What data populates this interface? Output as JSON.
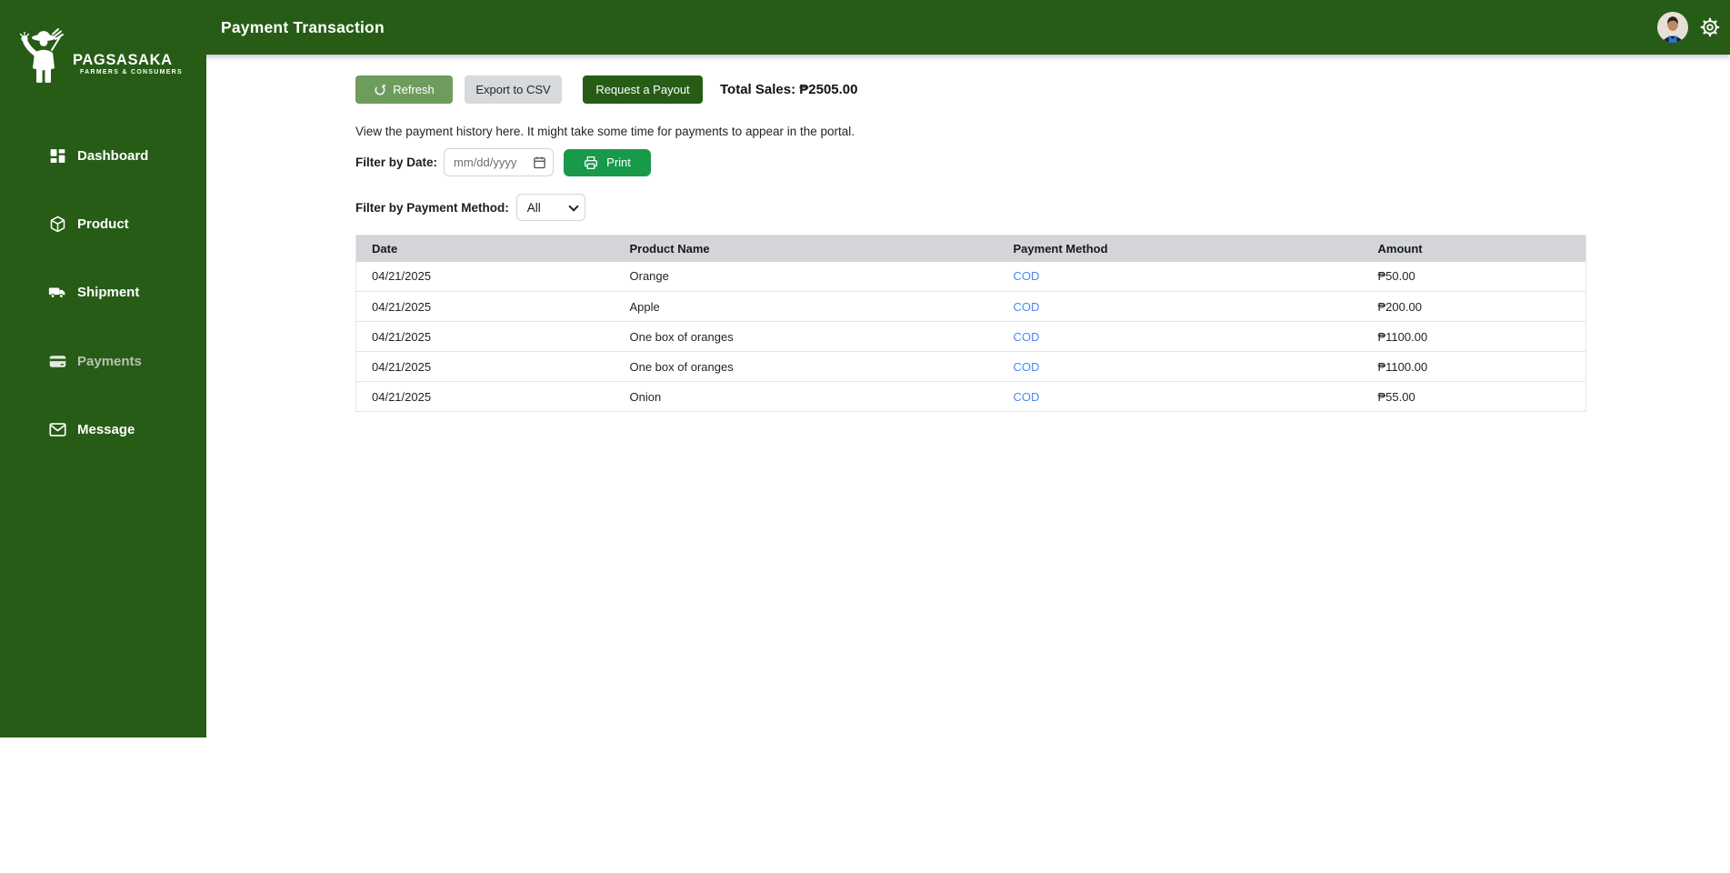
{
  "header": {
    "title": "Payment Transaction"
  },
  "sidebar": {
    "logo": {
      "title": "PAGSASAKA",
      "subtitle": "FARMERS & CONSUMERS",
      "icon": "farmer-logo-icon"
    },
    "items": [
      {
        "label": "Dashboard",
        "icon": "dashboard-grid-icon",
        "active": false
      },
      {
        "label": "Product",
        "icon": "box-icon",
        "active": false
      },
      {
        "label": "Shipment",
        "icon": "truck-icon",
        "active": false
      },
      {
        "label": "Payments",
        "icon": "credit-card-icon",
        "active": true
      },
      {
        "label": "Message",
        "icon": "envelope-icon",
        "active": false
      }
    ]
  },
  "toolbar": {
    "refresh_label": "Refresh",
    "export_label": "Export to CSV",
    "payout_label": "Request a Payout",
    "total_sales_label": "Total Sales:",
    "total_sales_value": "₱2505.00"
  },
  "info_text": "View the payment history here. It might take some time for payments to appear in the portal.",
  "filters": {
    "date_label": "Filter by Date:",
    "date_placeholder": "mm/dd/yyyy",
    "print_label": "Print",
    "method_label": "Filter by Payment Method:",
    "method_value": "All"
  },
  "table": {
    "columns": [
      "Date",
      "Product Name",
      "Payment Method",
      "Amount"
    ],
    "rows": [
      {
        "date": "04/21/2025",
        "product": "Orange",
        "method": "COD",
        "amount": "₱50.00"
      },
      {
        "date": "04/21/2025",
        "product": "Apple",
        "method": "COD",
        "amount": "₱200.00"
      },
      {
        "date": "04/21/2025",
        "product": "One box of oranges",
        "method": "COD",
        "amount": "₱1100.00"
      },
      {
        "date": "04/21/2025",
        "product": "One box of oranges",
        "method": "COD",
        "amount": "₱1100.00"
      },
      {
        "date": "04/21/2025",
        "product": "Onion",
        "method": "COD",
        "amount": "₱55.00"
      }
    ]
  },
  "colors": {
    "brand_green": "#275c16",
    "refresh_green": "#6d9c5d",
    "print_green": "#189a4a",
    "button_gray": "#d7d9db",
    "table_header_gray": "#d3d5d9",
    "link_blue": "#4a8af5"
  }
}
